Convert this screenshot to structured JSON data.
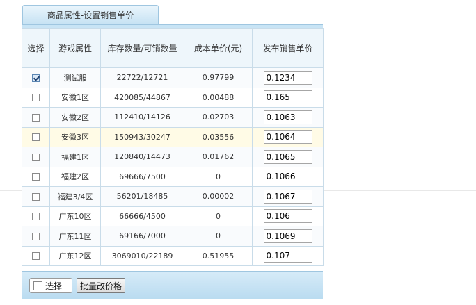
{
  "tab": {
    "title": "商品属性-设置销售单价"
  },
  "table": {
    "headers": [
      "选择",
      "游戏属性",
      "库存数量/可销数量",
      "成本单价(元)",
      "发布销售单价"
    ],
    "rows": [
      {
        "checked": true,
        "attr": "测试服",
        "stock": "22722/12721",
        "cost": "0.97799",
        "price": "0.1234"
      },
      {
        "checked": false,
        "attr": "安徽1区",
        "stock": "420085/44867",
        "cost": "0.00488",
        "price": "0.165"
      },
      {
        "checked": false,
        "attr": "安徽2区",
        "stock": "112410/14126",
        "cost": "0.02703",
        "price": "0.1063"
      },
      {
        "checked": false,
        "attr": "安徽3区",
        "stock": "150943/30247",
        "cost": "0.03556",
        "price": "0.1064"
      },
      {
        "checked": false,
        "attr": "福建1区",
        "stock": "120840/14473",
        "cost": "0.01762",
        "price": "0.1065"
      },
      {
        "checked": false,
        "attr": "福建2区",
        "stock": "69666/7500",
        "cost": "0",
        "price": "0.1066"
      },
      {
        "checked": false,
        "attr": "福建3/4区",
        "stock": "56201/18485",
        "cost": "0.00002",
        "price": "0.1067"
      },
      {
        "checked": false,
        "attr": "广东10区",
        "stock": "66666/4500",
        "cost": "0",
        "price": "0.106"
      },
      {
        "checked": false,
        "attr": "广东11区",
        "stock": "69166/7000",
        "cost": "0",
        "price": "0.1069"
      },
      {
        "checked": false,
        "attr": "广东12区",
        "stock": "3069010/22189",
        "cost": "0.51955",
        "price": "0.107"
      }
    ],
    "highlighted_row": 3
  },
  "footer": {
    "select_label": "选择",
    "batch_label": "批量改价格"
  }
}
